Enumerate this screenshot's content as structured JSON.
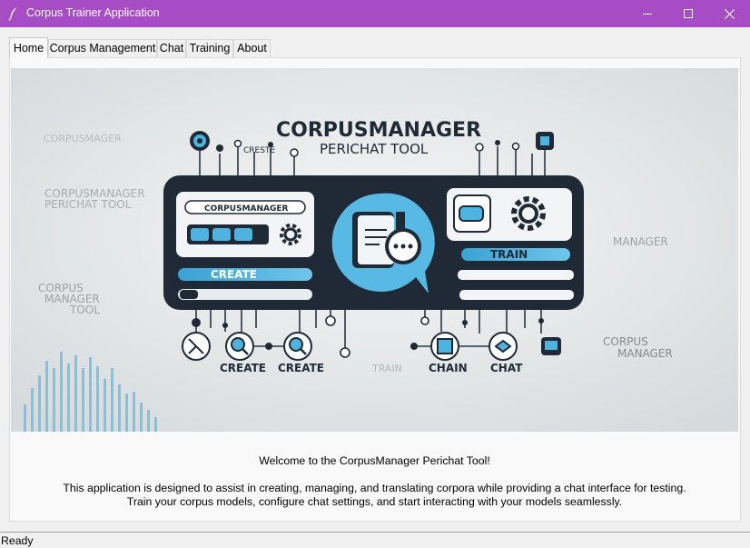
{
  "window": {
    "title": "Corpus Trainer Application"
  },
  "tabs": [
    {
      "label": "Home",
      "active": true
    },
    {
      "label": "Corpus Management",
      "active": false
    },
    {
      "label": "Chat",
      "active": false
    },
    {
      "label": "Training",
      "active": false
    },
    {
      "label": "About",
      "active": false
    }
  ],
  "banner": {
    "title_line1": "CORPUSMANAGER",
    "title_line2": "PERICHAT TOOL",
    "small_label_top": "CRESTE",
    "left_text_1": "CORPUSMAGER",
    "left_text_2a": "CORPUSMANAGER",
    "left_text_2b": "PERICHAT TOOL",
    "left_text_3a": "CORPUS",
    "left_text_3b": "MANAGER",
    "left_text_3c": "TOOL",
    "right_text_1": "MANAGER",
    "right_text_2a": "CORPUS",
    "right_text_2b": "MANAGER",
    "panel_label": "CORPUSMANAGER",
    "create_button": "CREATE",
    "train_button": "TRAIN",
    "bottom_labels": [
      "CREATE",
      "CREATE",
      "TRAIN",
      "CHAIN",
      "CHAT"
    ],
    "colors": {
      "accent": "#4fb3e0",
      "dark": "#1f2a36",
      "background": "#e8eaeb"
    }
  },
  "welcome": {
    "line1": "Welcome to the CorpusManager Perichat Tool!",
    "line2": "This application is designed to assist in creating, managing, and translating corpora while providing a chat interface for testing.",
    "line3": "Train your corpus models, configure chat settings, and start interacting with your models seamlessly."
  },
  "status": "Ready"
}
